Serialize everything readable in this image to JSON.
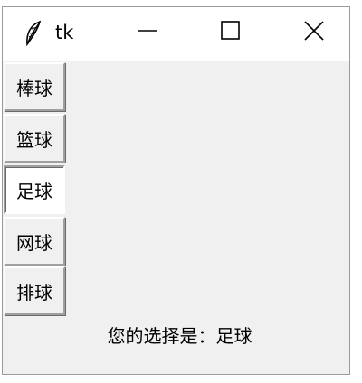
{
  "window": {
    "title": "tk",
    "icon": "feather-icon",
    "controls": [
      "minimize-icon",
      "maximize-icon",
      "close-icon"
    ]
  },
  "options": [
    {
      "label": "棒球",
      "selected": false
    },
    {
      "label": "篮球",
      "selected": false
    },
    {
      "label": "足球",
      "selected": true
    },
    {
      "label": "网球",
      "selected": false
    },
    {
      "label": "排球",
      "selected": false
    }
  ],
  "result": {
    "text": "您的选择是：足球"
  }
}
